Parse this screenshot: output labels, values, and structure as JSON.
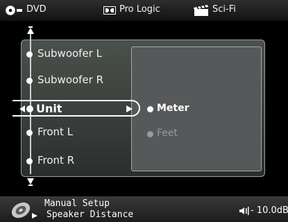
{
  "status_bar": {
    "source": "DVD",
    "audio_mode": "Pro Logic",
    "sound_field": "Sci-Fi"
  },
  "menu": {
    "items": [
      {
        "label": "Subwoofer L"
      },
      {
        "label": "Subwoofer R"
      },
      {
        "label": "Unit"
      },
      {
        "label": "Front L"
      },
      {
        "label": "Front R"
      }
    ],
    "selected_index": 2
  },
  "options": [
    {
      "label": "Meter",
      "selected": true
    },
    {
      "label": "Feet",
      "selected": false
    }
  ],
  "bottom_bar": {
    "line1": "Manual Setup",
    "line2": "Speaker Distance",
    "volume": "- 10.0dB"
  },
  "colors": {
    "panel": "#3f4441",
    "subpanel": "#56585a",
    "accent": "#ffffff",
    "disabled": "#9a9a9a"
  }
}
